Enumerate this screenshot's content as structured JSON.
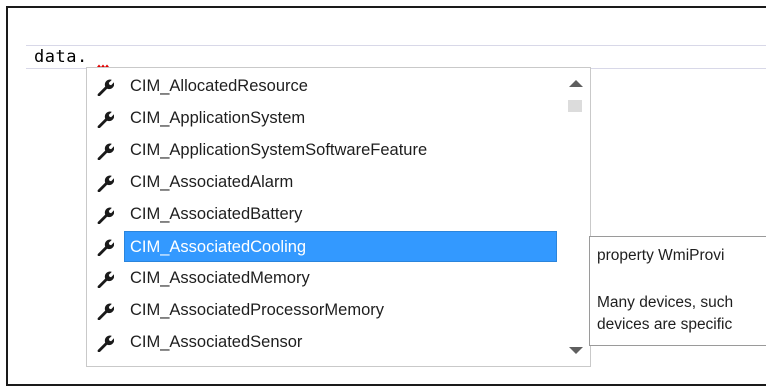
{
  "editor": {
    "code_text": "data."
  },
  "completion": {
    "items": [
      {
        "label": "CIM_AllocatedResource",
        "icon": "wrench-icon"
      },
      {
        "label": "CIM_ApplicationSystem",
        "icon": "wrench-icon"
      },
      {
        "label": "CIM_ApplicationSystemSoftwareFeature",
        "icon": "wrench-icon"
      },
      {
        "label": "CIM_AssociatedAlarm",
        "icon": "wrench-icon"
      },
      {
        "label": "CIM_AssociatedBattery",
        "icon": "wrench-icon"
      },
      {
        "label": "CIM_AssociatedCooling",
        "icon": "wrench-icon"
      },
      {
        "label": "CIM_AssociatedMemory",
        "icon": "wrench-icon"
      },
      {
        "label": "CIM_AssociatedProcessorMemory",
        "icon": "wrench-icon"
      },
      {
        "label": "CIM_AssociatedSensor",
        "icon": "wrench-icon"
      }
    ],
    "selected_index": 5,
    "selection_color": "#3399ff"
  },
  "tooltip": {
    "signature": "property WmiProvi",
    "description_line1": "Many devices, such",
    "description_line2": "devices are specific"
  }
}
